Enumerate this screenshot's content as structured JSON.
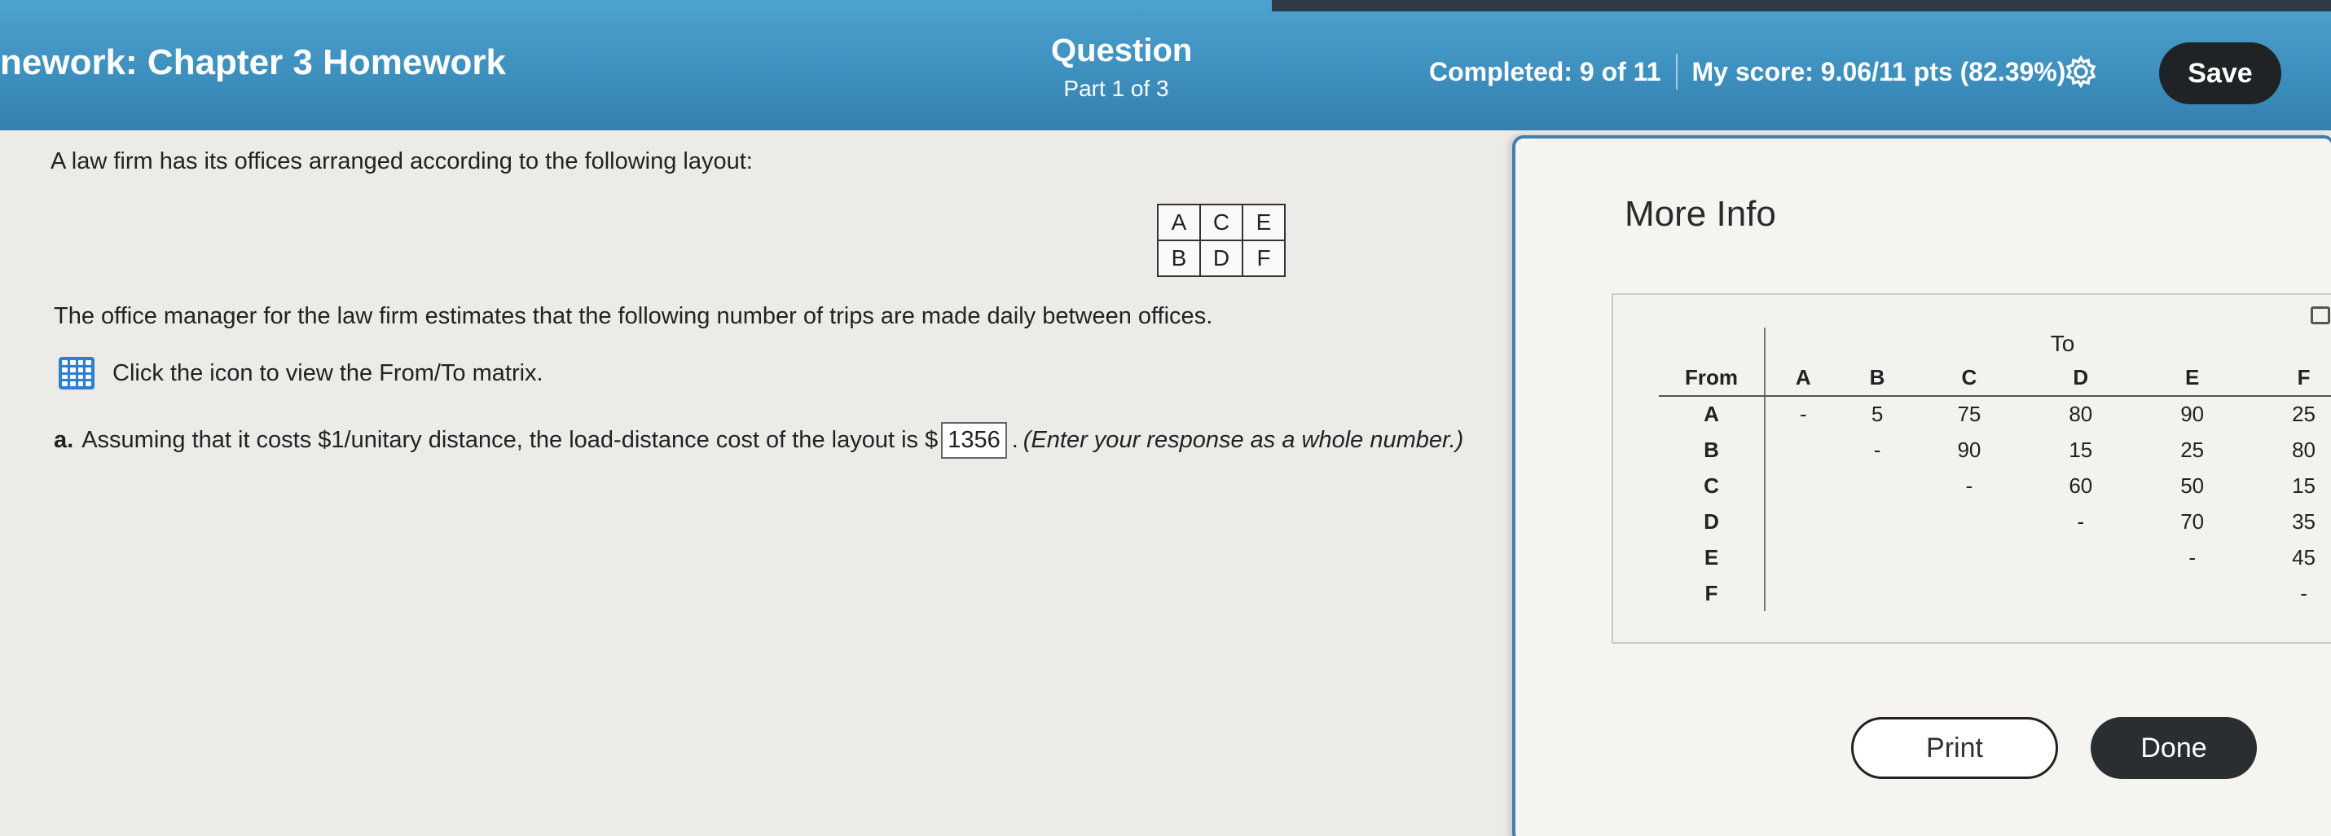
{
  "header": {
    "homework_title": "nework:  Chapter 3 Homework",
    "question_label": "Question",
    "question_part": "Part 1 of 3",
    "completed": "Completed: 9 of 11",
    "score": "My score: 9.06/11 pts (82.39%)",
    "save_label": "Save",
    "settings_icon": "gear-icon"
  },
  "problem": {
    "intro": "A law firm has its offices arranged according to the following layout:",
    "layout": [
      [
        "A",
        "C",
        "E"
      ],
      [
        "B",
        "D",
        "F"
      ]
    ],
    "manager_text": "The office manager for the law firm estimates that the following number of trips are made daily between offices.",
    "matrix_link": "Click the icon to view the From/To matrix.",
    "part_a_label": "a.",
    "part_a_text": "Assuming that it costs $1/unitary distance, the load-distance cost of the layout is $",
    "part_a_answer": "1356",
    "part_a_end": ".",
    "part_a_hint": "(Enter your response as a whole number.)"
  },
  "popup": {
    "title": "More Info",
    "to_label": "To",
    "from_label": "From",
    "columns": [
      "A",
      "B",
      "C",
      "D",
      "E",
      "F"
    ],
    "rows": [
      {
        "from": "A",
        "values": [
          "-",
          "5",
          "75",
          "80",
          "90",
          "25"
        ]
      },
      {
        "from": "B",
        "values": [
          "",
          "-",
          "90",
          "15",
          "25",
          "80"
        ]
      },
      {
        "from": "C",
        "values": [
          "",
          "",
          "-",
          "60",
          "50",
          "15"
        ]
      },
      {
        "from": "D",
        "values": [
          "",
          "",
          "",
          "-",
          "70",
          "35"
        ]
      },
      {
        "from": "E",
        "values": [
          "",
          "",
          "",
          "",
          "-",
          "45"
        ]
      },
      {
        "from": "F",
        "values": [
          "",
          "",
          "",
          "",
          "",
          "-"
        ]
      }
    ],
    "print_label": "Print",
    "done_label": "Done"
  },
  "colors": {
    "header_blue": "#3c8ebd",
    "button_dark": "#1f2326",
    "popup_border": "#3f7fb0",
    "matrix_icon": "#2c7fd1"
  }
}
